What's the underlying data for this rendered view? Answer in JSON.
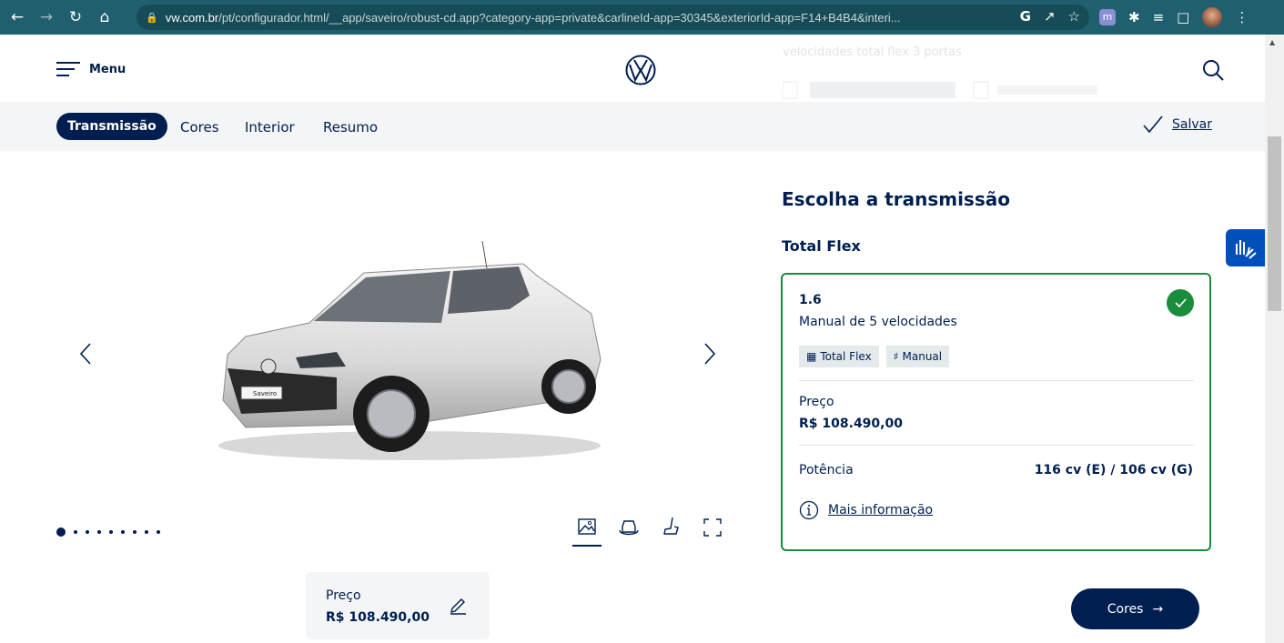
{
  "browser": {
    "url_host": "vw.com.br",
    "url_path": "/pt/configurador.html/__app/saveiro/robust-cd.app?category-app=private&carlineId-app=30345&exteriorId-app=F14+B4B4&interi...",
    "icons": [
      "back-icon",
      "forward-icon",
      "reload-icon",
      "home-icon",
      "lock-icon",
      "google-icon",
      "share-icon",
      "star-icon",
      "extension-icon",
      "puzzle-icon",
      "media-icon",
      "sidepanel-icon",
      "profile-avatar",
      "kebab-menu-icon"
    ]
  },
  "header": {
    "menu_label": "Menu",
    "ghost_text": "velocidades total flex 3 portas"
  },
  "steps": {
    "active": "Transmissão",
    "tabs": [
      "Cores",
      "Interior",
      "Resumo"
    ],
    "save_label": "Salvar"
  },
  "gallery": {
    "slide_count": 9,
    "active_slide": 1
  },
  "price_summary": {
    "label": "Preço",
    "value": "R$ 108.490,00"
  },
  "panel": {
    "title": "Escolha a transmissão",
    "group": "Total Flex",
    "option": {
      "engine": "1.6",
      "description": "Manual de 5 velocidades",
      "chips": [
        {
          "icon": "fuel-icon",
          "label": "Total Flex"
        },
        {
          "icon": "gearbox-icon",
          "label": "Manual"
        }
      ],
      "price_label": "Preço",
      "price_value": "R$ 108.490,00",
      "power_label": "Potência",
      "power_value": "116 cv (E) / 106 cv (G)",
      "more_label": "Mais informação"
    },
    "next_label": "Cores"
  },
  "colors": {
    "navy": "#001e50",
    "selected_green": "#1a8d3c",
    "a11y_blue": "#004fba"
  }
}
